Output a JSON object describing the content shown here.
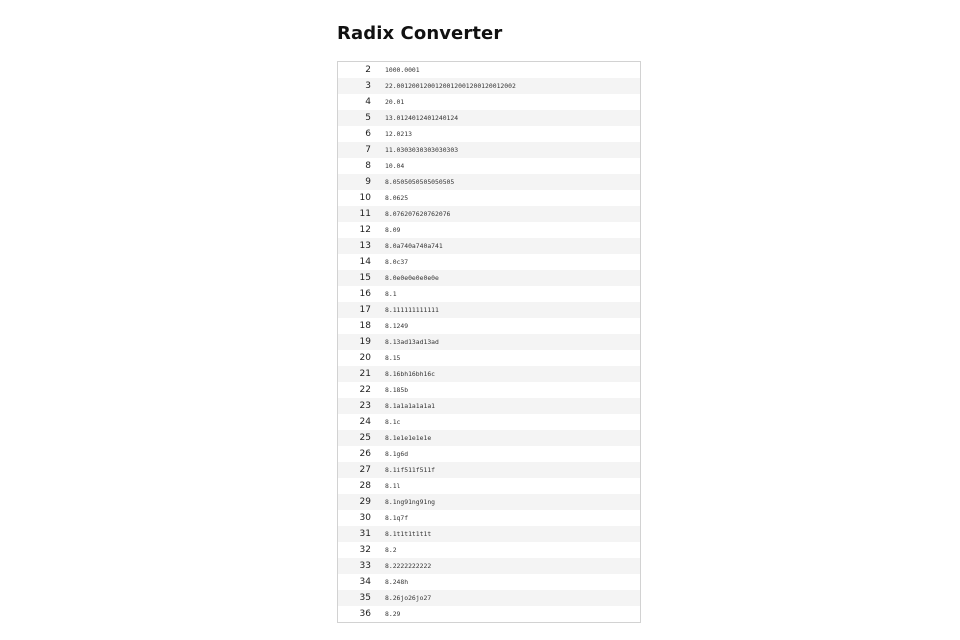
{
  "title": "Radix Converter",
  "rows": [
    {
      "radix": "2",
      "value": "1000.0001"
    },
    {
      "radix": "3",
      "value": "22.0012001200120012001200120012002"
    },
    {
      "radix": "4",
      "value": "20.01"
    },
    {
      "radix": "5",
      "value": "13.0124012401240124"
    },
    {
      "radix": "6",
      "value": "12.0213"
    },
    {
      "radix": "7",
      "value": "11.0303030303030303"
    },
    {
      "radix": "8",
      "value": "10.04"
    },
    {
      "radix": "9",
      "value": "8.0505050505050505"
    },
    {
      "radix": "10",
      "value": "8.0625"
    },
    {
      "radix": "11",
      "value": "8.076207620762076"
    },
    {
      "radix": "12",
      "value": "8.09"
    },
    {
      "radix": "13",
      "value": "8.0a740a740a741"
    },
    {
      "radix": "14",
      "value": "8.0c37"
    },
    {
      "radix": "15",
      "value": "8.0e0e0e0e0e0e"
    },
    {
      "radix": "16",
      "value": "8.1"
    },
    {
      "radix": "17",
      "value": "8.111111111111"
    },
    {
      "radix": "18",
      "value": "8.1249"
    },
    {
      "radix": "19",
      "value": "8.13ad13ad13ad"
    },
    {
      "radix": "20",
      "value": "8.15"
    },
    {
      "radix": "21",
      "value": "8.16bh16bh16c"
    },
    {
      "radix": "22",
      "value": "8.185b"
    },
    {
      "radix": "23",
      "value": "8.1a1a1a1a1a1"
    },
    {
      "radix": "24",
      "value": "8.1c"
    },
    {
      "radix": "25",
      "value": "8.1e1e1e1e1e"
    },
    {
      "radix": "26",
      "value": "8.1g6d"
    },
    {
      "radix": "27",
      "value": "8.1if511f511f"
    },
    {
      "radix": "28",
      "value": "8.1l"
    },
    {
      "radix": "29",
      "value": "8.1ng91ng91ng"
    },
    {
      "radix": "30",
      "value": "8.1q7f"
    },
    {
      "radix": "31",
      "value": "8.1t1t1t1t1t"
    },
    {
      "radix": "32",
      "value": "8.2"
    },
    {
      "radix": "33",
      "value": "8.2222222222"
    },
    {
      "radix": "34",
      "value": "8.248h"
    },
    {
      "radix": "35",
      "value": "8.26jo26jo27"
    },
    {
      "radix": "36",
      "value": "8.29"
    }
  ]
}
